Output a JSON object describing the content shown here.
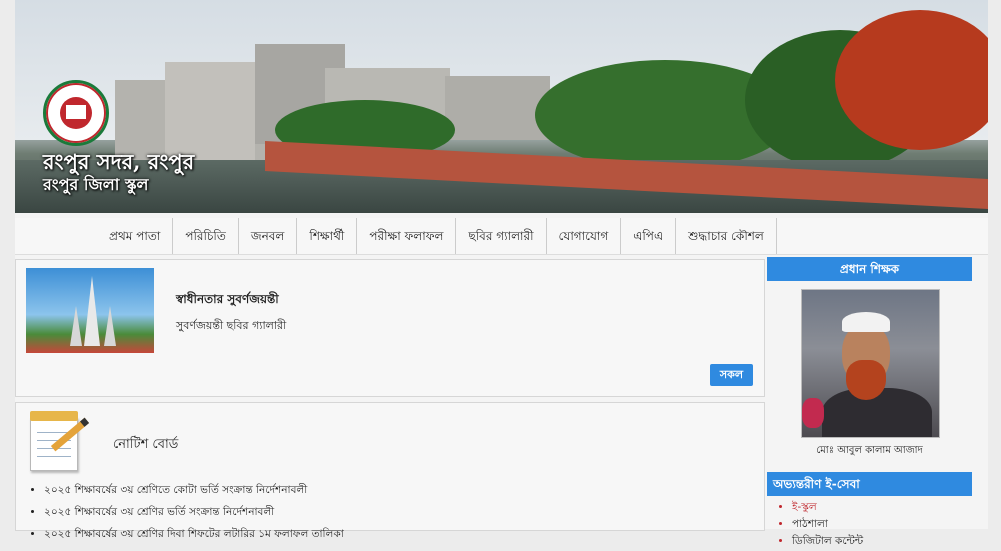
{
  "site": {
    "title": "রংপুর সদর, রংপুর",
    "subtitle": "রংপুর জিলা স্কুল"
  },
  "nav": {
    "items": [
      "প্রথম পাতা",
      "পরিচিতি",
      "জনবল",
      "শিক্ষার্থী",
      "পরীক্ষা ফলাফল",
      "ছবির গ্যালারী",
      "যোগাযোগ",
      "এপিএ",
      "শুদ্ধাচার কৌশল"
    ]
  },
  "gallery": {
    "title": "স্বাধীনতার সুবর্ণজয়ন্তী",
    "link": "সুবর্ণজয়ন্তী ছবির গ্যালারী",
    "all_button": "সকল"
  },
  "notice": {
    "title": "নোটিশ বোর্ড",
    "items": [
      "২০২৫ শিক্ষাবর্ষের ৩য় শ্রেণিতে কোটা ভর্তি সংক্রান্ত নির্দেশনাবলী",
      "২০২৫ শিক্ষাবর্ষের ৩য় শ্রেণির ভর্তি সংক্রান্ত নির্দেশনাবলী",
      "২০২৫ শিক্ষাবর্ষের ৩য় শ্রেণির দিবা শিফটের লটারির ১ম ফলাফল তালিকা"
    ]
  },
  "sidebar": {
    "head_teacher_title": "প্রধান শিক্ষক",
    "head_teacher_name": "মোঃ আবুল কালাম আজাদ",
    "eservice_title": "অভ্যন্তরীণ ই-সেবা",
    "eservice_items": [
      "ই-স্কুল",
      "পাঠশালা",
      "ডিজিটাল কন্টেন্ট"
    ]
  },
  "colors": {
    "accent": "#2f8ae0",
    "brand_green": "#1a7a3a",
    "brand_red": "#c0272d"
  }
}
